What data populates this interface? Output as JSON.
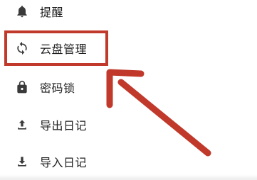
{
  "menu": {
    "items": [
      {
        "label": "提醒",
        "icon": "bell-icon"
      },
      {
        "label": "云盘管理",
        "icon": "sync-icon"
      },
      {
        "label": "密码锁",
        "icon": "lock-icon"
      },
      {
        "label": "导出日记",
        "icon": "upload-icon"
      },
      {
        "label": "导入日记",
        "icon": "download-icon"
      }
    ]
  },
  "annotation": {
    "highlight_color": "#c0392b",
    "highlighted_item": "云盘管理"
  },
  "colors": {
    "text": "#1f1f1f",
    "icon": "#3a3a3a",
    "background": "#ffffff"
  }
}
